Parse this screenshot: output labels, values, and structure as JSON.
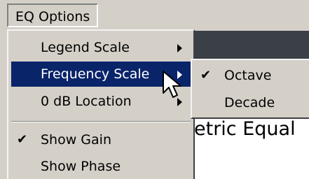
{
  "menubar": {
    "title": "EQ Options"
  },
  "main_menu": {
    "items": [
      {
        "label": "Legend Scale",
        "submenu": true
      },
      {
        "label": "Frequency Scale",
        "submenu": true,
        "highlighted": true
      },
      {
        "label": "0 dB Location",
        "submenu": true
      },
      {
        "label": "Show Gain",
        "checked": true,
        "check_mark": "✔"
      },
      {
        "label": "Show Phase"
      }
    ]
  },
  "submenu": {
    "items": [
      {
        "label": "Octave",
        "checked": true,
        "check_mark": "✔"
      },
      {
        "label": "Decade"
      }
    ]
  },
  "background_window": {
    "heading_fragment": "etric Equal"
  },
  "colors": {
    "highlight": "#0a246a",
    "menu_face": "#d4d0c8"
  },
  "icons": {
    "submenu_arrow": "arrow-right-icon",
    "check": "checkmark-icon",
    "pointer": "mouse-cursor-icon"
  }
}
